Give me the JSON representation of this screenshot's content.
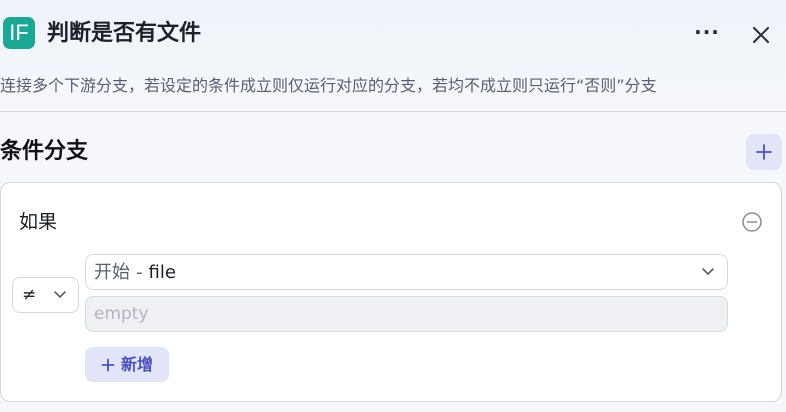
{
  "node": {
    "icon_text": "IF",
    "title": "判断是否有文件",
    "more_label": "···",
    "description": "连接多个下游分支，若设定的条件成立则仅运行对应的分支，若均不成立则只运行“否则”分支"
  },
  "section": {
    "title": "条件分支"
  },
  "branch": {
    "label": "如果",
    "condition": {
      "operator_symbol": "≠",
      "variable_source": "开始",
      "variable_separator": "-",
      "variable_name": "file",
      "value_placeholder": "empty",
      "value": ""
    },
    "add_condition_label": "新增"
  },
  "colors": {
    "icon_bg": "#18a893",
    "accent": "#4a4fbf",
    "accent_bg": "#e2e4f8"
  },
  "icons": {
    "more": "more-horizontal-icon",
    "close": "close-icon",
    "add": "plus-icon",
    "remove": "minus-circle-icon",
    "chevron": "chevron-down-icon"
  }
}
